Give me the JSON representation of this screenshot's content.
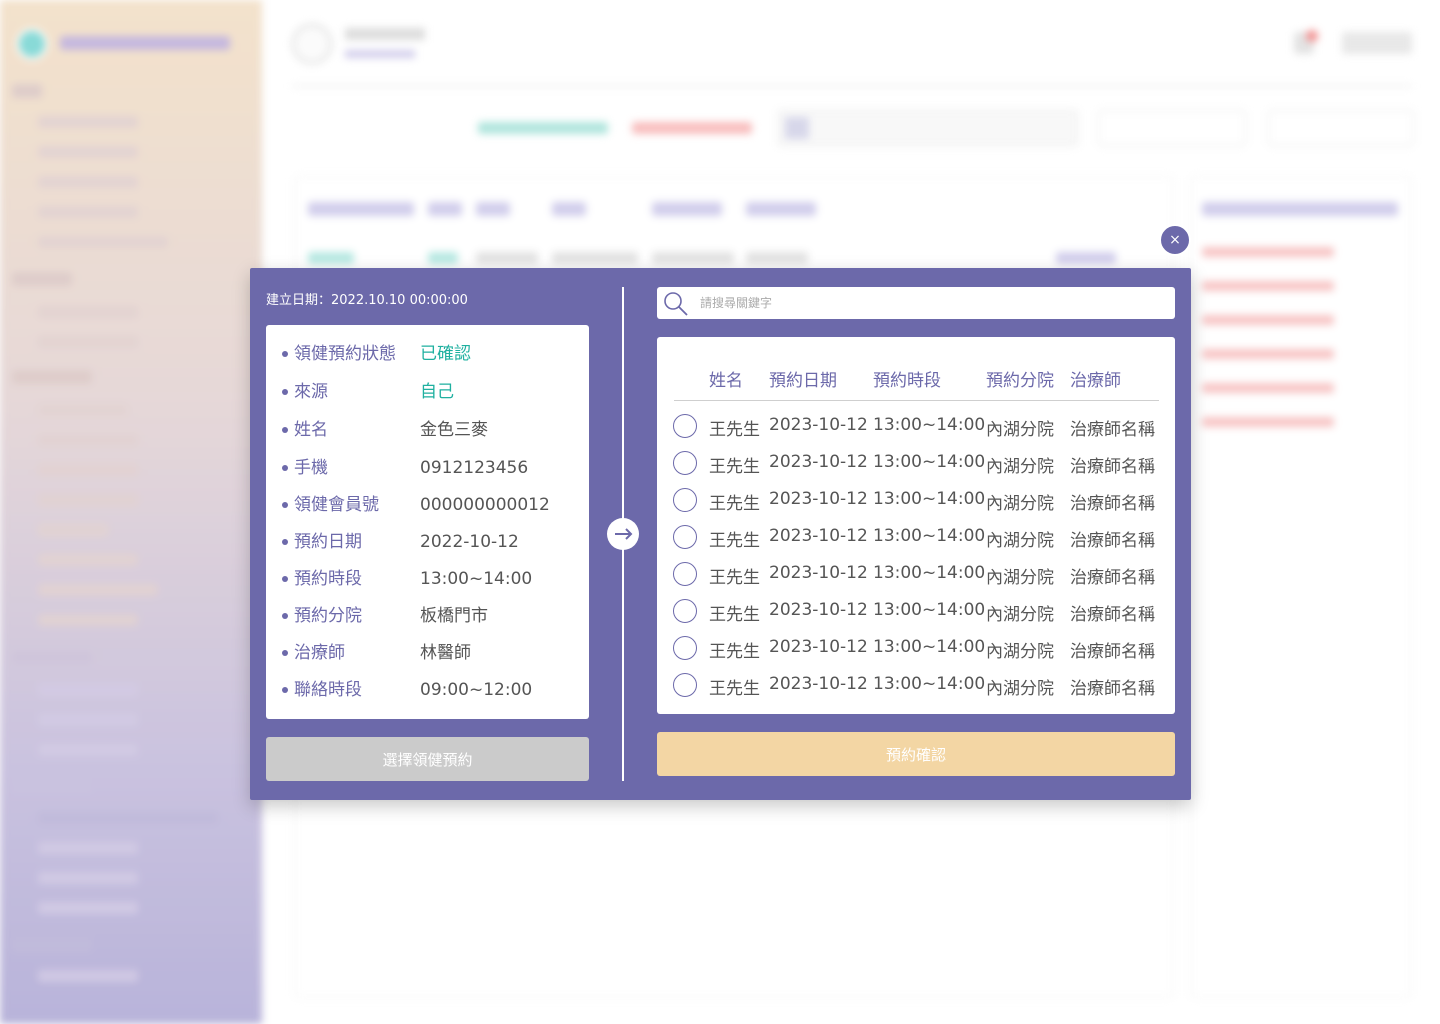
{
  "modal": {
    "created_label": "建立日期：2022.10.10 00:00:00",
    "close_glyph": "×",
    "info": [
      {
        "key": "領健預約狀態",
        "value": "已確認",
        "highlight": true
      },
      {
        "key": "來源",
        "value": "自己",
        "highlight": true
      },
      {
        "key": "姓名",
        "value": "金色三麥",
        "highlight": false
      },
      {
        "key": "手機",
        "value": "0912123456",
        "highlight": false
      },
      {
        "key": "領健會員號",
        "value": "000000000012",
        "highlight": false
      },
      {
        "key": "預約日期",
        "value": "2022-10-12",
        "highlight": false
      },
      {
        "key": "預約時段",
        "value": "13:00~14:00",
        "highlight": false
      },
      {
        "key": "預約分院",
        "value": "板橋門市",
        "highlight": false
      },
      {
        "key": "治療師",
        "value": "林醫師",
        "highlight": false
      },
      {
        "key": "聯絡時段",
        "value": "09:00~12:00",
        "highlight": false
      }
    ],
    "choose_button": "選擇領健預約",
    "search_placeholder": "請搜尋關鍵字",
    "list_headers": [
      "姓名",
      "預約日期",
      "預約時段",
      "預約分院",
      "治療師"
    ],
    "list_rows": [
      [
        "王先生",
        "2023-10-12",
        "13:00~14:00",
        "內湖分院",
        "治療師名稱"
      ],
      [
        "王先生",
        "2023-10-12",
        "13:00~14:00",
        "內湖分院",
        "治療師名稱"
      ],
      [
        "王先生",
        "2023-10-12",
        "13:00~14:00",
        "內湖分院",
        "治療師名稱"
      ],
      [
        "王先生",
        "2023-10-12",
        "13:00~14:00",
        "內湖分院",
        "治療師名稱"
      ],
      [
        "王先生",
        "2023-10-12",
        "13:00~14:00",
        "內湖分院",
        "治療師名稱"
      ],
      [
        "王先生",
        "2023-10-12",
        "13:00~14:00",
        "內湖分院",
        "治療師名稱"
      ],
      [
        "王先生",
        "2023-10-12",
        "13:00~14:00",
        "內湖分院",
        "治療師名稱"
      ],
      [
        "王先生",
        "2023-10-12",
        "13:00~14:00",
        "內湖分院",
        "治療師名稱"
      ]
    ],
    "confirm_button": "預約確認"
  },
  "colors": {
    "modal_bg": "#6c69aa",
    "accent_teal": "#1fb0a0",
    "disabled_button": "#cbcbcb",
    "confirm_button": "#f3d6a4"
  },
  "icons": {
    "close": "close-icon",
    "arrow": "arrow-right-icon",
    "search": "search-icon",
    "radio": "radio-icon"
  }
}
